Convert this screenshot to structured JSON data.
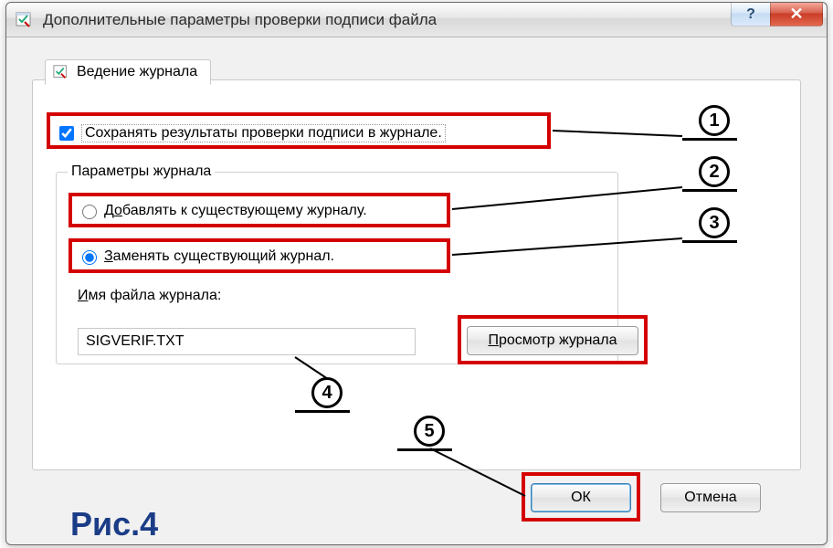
{
  "window": {
    "title": "Дополнительные параметры проверки подписи файла",
    "help_symbol": "?",
    "close_symbol": "✕"
  },
  "tab": {
    "label": "Ведение журнала"
  },
  "save_results": {
    "label": "Сохранять результаты проверки подписи в журнале.",
    "checked": true
  },
  "log_params": {
    "legend": "Параметры журнала",
    "append": {
      "label": "Добавлять к существующему журналу.",
      "underline_idx": 1
    },
    "replace": {
      "label": "Заменять существующий журнал.",
      "underline_idx": 0,
      "selected": true
    },
    "filename_label": "Имя файла журнала:",
    "filename_value": "SIGVERIF.TXT",
    "view_button": "Просмотр журнала"
  },
  "buttons": {
    "ok": "ОК",
    "cancel": "Отмена"
  },
  "callouts": {
    "n1": "1",
    "n2": "2",
    "n3": "3",
    "n4": "4",
    "n5": "5"
  },
  "figure_label": "Рис.4"
}
